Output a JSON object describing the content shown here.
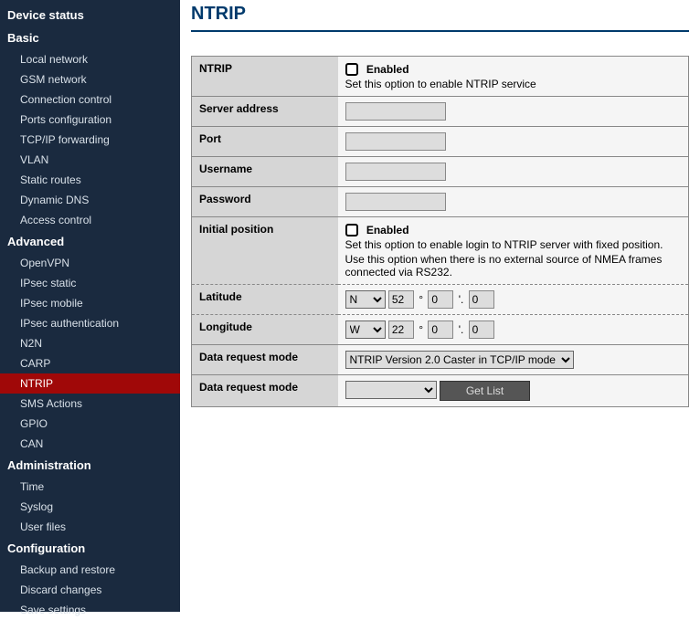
{
  "page_title": "NTRIP",
  "sidebar": {
    "sections": [
      {
        "title": "Device status",
        "items": []
      },
      {
        "title": "Basic",
        "items": [
          "Local network",
          "GSM network",
          "Connection control",
          "Ports configuration",
          "TCP/IP forwarding",
          "VLAN",
          "Static routes",
          "Dynamic DNS",
          "Access control"
        ]
      },
      {
        "title": "Advanced",
        "items": [
          "OpenVPN",
          "IPsec static",
          "IPsec mobile",
          "IPsec authentication",
          "N2N",
          "CARP",
          "NTRIP",
          "SMS Actions",
          "GPIO",
          "CAN"
        ],
        "active": "NTRIP"
      },
      {
        "title": "Administration",
        "items": [
          "Time",
          "Syslog",
          "User files"
        ]
      },
      {
        "title": "Configuration",
        "items": [
          "Backup and restore",
          "Discard changes",
          "Save settings"
        ]
      }
    ]
  },
  "form": {
    "ntrip": {
      "label": "NTRIP",
      "enabled_label": "Enabled",
      "desc": "Set this option to enable NTRIP service",
      "checked": false
    },
    "server": {
      "label": "Server address",
      "value": ""
    },
    "port": {
      "label": "Port",
      "value": ""
    },
    "user": {
      "label": "Username",
      "value": ""
    },
    "pass": {
      "label": "Password",
      "value": ""
    },
    "initpos": {
      "label": "Initial position",
      "enabled_label": "Enabled",
      "desc1": "Set this option to enable login to NTRIP server with fixed position.",
      "desc2": "Use this option when there is no external source of NMEA frames connected via RS232.",
      "checked": false
    },
    "lat": {
      "label": "Latitude",
      "dir": "N",
      "deg": "52",
      "min": "0",
      "sec": "0"
    },
    "lon": {
      "label": "Longitude",
      "dir": "W",
      "deg": "22",
      "min": "0",
      "sec": "0"
    },
    "reqmode1": {
      "label": "Data request mode",
      "value": "NTRIP Version 2.0 Caster in TCP/IP mode"
    },
    "reqmode2": {
      "label": "Data request mode",
      "value": "",
      "button": "Get List"
    }
  }
}
